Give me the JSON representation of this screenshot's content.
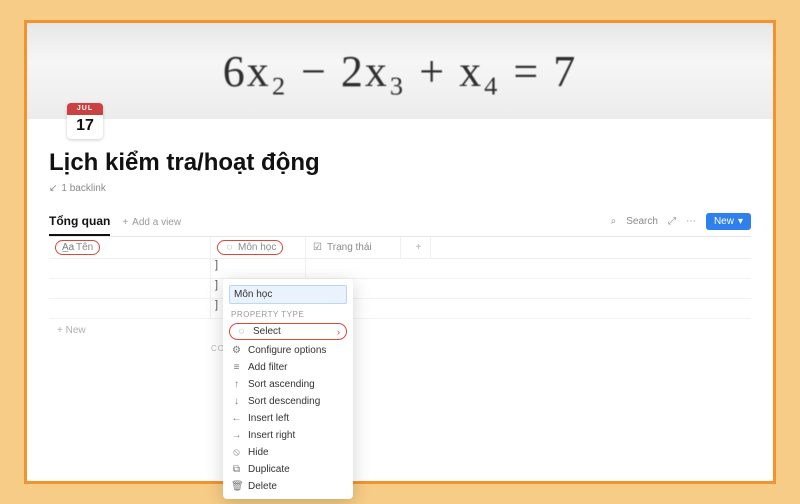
{
  "cover": {
    "math_expr": "6x₂ − 2x₃ + x₄ = 7"
  },
  "icon": {
    "month": "JUL",
    "day": "17"
  },
  "page": {
    "title": "Lịch kiểm tra/hoạt động",
    "backlink_text": "1 backlink"
  },
  "views": {
    "active_tab": "Tổng quan",
    "add_view": "Add a view"
  },
  "toolbar": {
    "search": "Search",
    "new": "New"
  },
  "columns": {
    "col1": "Tên",
    "col2": "Môn học",
    "col3": "Trạng thái",
    "add": "+"
  },
  "newrow": "+  New",
  "count_label": "COUNT",
  "popover": {
    "input_value": "Môn học",
    "section_label": "PROPERTY TYPE",
    "select": "Select",
    "items": [
      {
        "icon": "⚙",
        "label": "Configure options"
      },
      {
        "icon": "≡",
        "label": "Add filter"
      },
      {
        "icon": "↑",
        "label": "Sort ascending"
      },
      {
        "icon": "↓",
        "label": "Sort descending"
      },
      {
        "icon": "←",
        "label": "Insert left"
      },
      {
        "icon": "→",
        "label": "Insert right"
      },
      {
        "icon": "⦸",
        "label": "Hide"
      },
      {
        "icon": "⧉",
        "label": "Duplicate"
      },
      {
        "icon": "🗑",
        "label": "Delete"
      }
    ]
  }
}
